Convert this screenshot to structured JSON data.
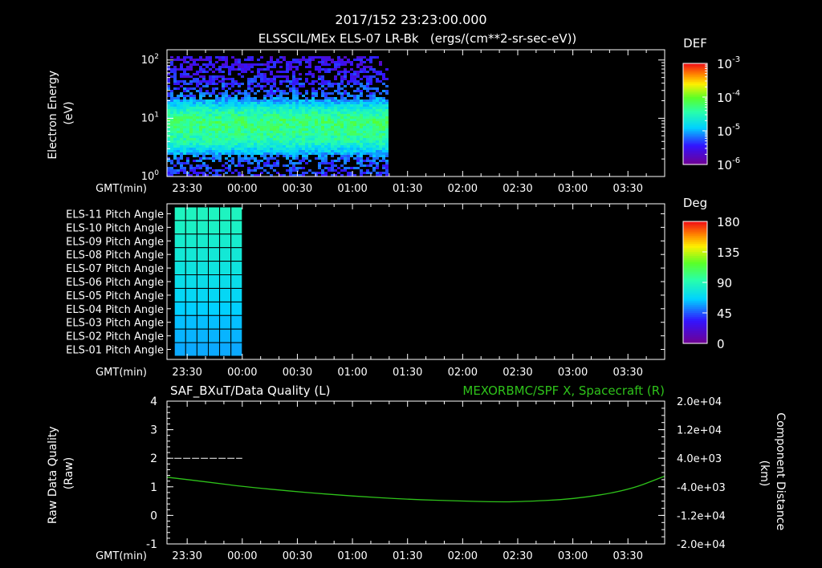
{
  "header": {
    "title": "2017/152 23:23:00.000",
    "subtitle": "ELSSCIL/MEx ELS-07 LR-Bk   (ergs/(cm**2-sr-sec-eV))"
  },
  "gmt_label": "GMT(min)",
  "time_ticks": [
    "23:30",
    "00:00",
    "00:30",
    "01:00",
    "01:30",
    "02:00",
    "02:30",
    "03:00",
    "03:30"
  ],
  "colors": {
    "background": "#000000",
    "foreground": "#ffffff",
    "component_line": "#2ec21a",
    "quality_line": "#ffffff"
  },
  "chart_data": [
    {
      "id": "energy-spectrogram",
      "type": "heatmap",
      "ylabel_line1": "Electron Energy",
      "ylabel_line2": "(eV)",
      "y_scale": "log",
      "ylim": [
        1,
        150
      ],
      "y_ticks": [
        {
          "base": "10",
          "exp": "0",
          "value": 1
        },
        {
          "base": "10",
          "exp": "1",
          "value": 10
        },
        {
          "base": "10",
          "exp": "2",
          "value": 100
        }
      ],
      "data_start": "23:19",
      "data_end": "01:19",
      "colorbar": {
        "title": "DEF",
        "scale": "log",
        "ticks": [
          {
            "base": "10",
            "exp": "-3",
            "value": 0.001
          },
          {
            "base": "10",
            "exp": "-4",
            "value": 0.0001
          },
          {
            "base": "10",
            "exp": "-5",
            "value": 1e-05
          },
          {
            "base": "10",
            "exp": "-6",
            "value": 1e-06
          }
        ]
      },
      "profile": [
        {
          "energy_ev": 1.0,
          "level": 0.2
        },
        {
          "energy_ev": 2.0,
          "level": 0.25
        },
        {
          "energy_ev": 3.0,
          "level": 0.4
        },
        {
          "energy_ev": 4.0,
          "level": 0.5
        },
        {
          "energy_ev": 6.0,
          "level": 0.55
        },
        {
          "energy_ev": 9.0,
          "level": 0.58
        },
        {
          "energy_ev": 13.0,
          "level": 0.5
        },
        {
          "energy_ev": 17.0,
          "level": 0.38
        },
        {
          "energy_ev": 25.0,
          "level": 0.25
        },
        {
          "energy_ev": 60.0,
          "level": 0.16
        },
        {
          "energy_ev": 150.0,
          "level": 0.13
        }
      ]
    },
    {
      "id": "pitch-angle",
      "type": "heatmap",
      "rows": [
        "ELS-11 Pitch Angle",
        "ELS-10 Pitch Angle",
        "ELS-09 Pitch Angle",
        "ELS-08 Pitch Angle",
        "ELS-07 Pitch Angle",
        "ELS-06 Pitch Angle",
        "ELS-05 Pitch Angle",
        "ELS-04 Pitch Angle",
        "ELS-03 Pitch Angle",
        "ELS-02 Pitch Angle",
        "ELS-01 Pitch Angle"
      ],
      "data_start": "23:23",
      "data_end": "00:00",
      "columns": 6,
      "values_deg": [
        87,
        85,
        82,
        79,
        76,
        72,
        68,
        64,
        61,
        59,
        57
      ],
      "colorbar": {
        "title": "Deg",
        "ticks": [
          180,
          135,
          90,
          45,
          0
        ],
        "min": 0,
        "max": 180
      }
    },
    {
      "id": "quality-component",
      "type": "line",
      "title_left": "SAF_BXuT/Data Quality (L)",
      "title_right": "MEXORBMC/SPF X, Spacecraft (R)",
      "ylabel_left_line1": "Raw Data Quality",
      "ylabel_left_line2": "(Raw)",
      "ylabel_right_line1": "Component Distance",
      "ylabel_right_line2": "(km)",
      "y_left": {
        "ticks": [
          4,
          3,
          2,
          1,
          0,
          -1
        ],
        "min": -1,
        "max": 4
      },
      "y_right": {
        "ticks": [
          "2.0e+04",
          "1.2e+04",
          "4.0e+03",
          "-4.0e+03",
          "-1.2e+04",
          "-2.0e+04"
        ],
        "min": -20000,
        "max": 20000
      },
      "series": [
        {
          "name": "SAF_BXuT/Data Quality",
          "axis": "left",
          "style": "dashed",
          "points": [
            {
              "t": "23:23",
              "v": 2
            },
            {
              "t": "00:00",
              "v": 2
            }
          ]
        },
        {
          "name": "MEXORBMC/SPF X, Spacecraft",
          "axis": "right",
          "points": [
            {
              "t": "23:19",
              "v": -1300
            },
            {
              "t": "23:45",
              "v": -2900
            },
            {
              "t": "00:00",
              "v": -3900
            },
            {
              "t": "00:30",
              "v": -5400
            },
            {
              "t": "01:00",
              "v": -6600
            },
            {
              "t": "01:30",
              "v": -7500
            },
            {
              "t": "02:00",
              "v": -8000
            },
            {
              "t": "02:15",
              "v": -8200
            },
            {
              "t": "02:30",
              "v": -8200
            },
            {
              "t": "03:00",
              "v": -7500
            },
            {
              "t": "03:30",
              "v": -5000
            },
            {
              "t": "03:50",
              "v": -1000
            }
          ]
        }
      ]
    }
  ]
}
